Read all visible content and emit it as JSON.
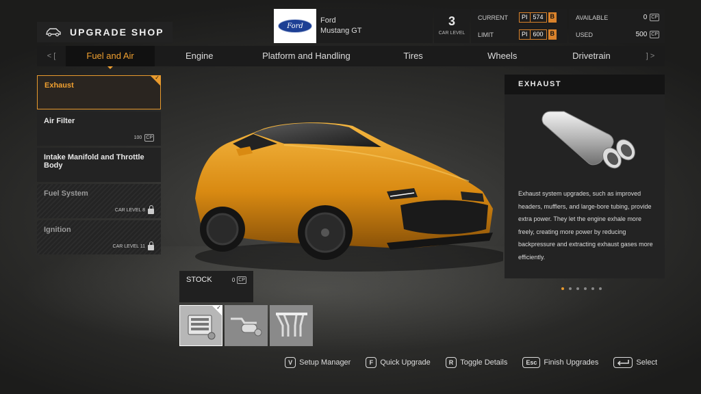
{
  "header": {
    "title": "UPGRADE SHOP",
    "car": {
      "logo": "Ford",
      "make": "Ford",
      "model": "Mustang GT"
    },
    "car_level": {
      "value": "3",
      "label": "CAR LEVEL"
    },
    "pi": {
      "current_label": "CURRENT",
      "current_value": "574",
      "current_class": "B",
      "limit_label": "LIMIT",
      "limit_value": "600",
      "limit_class": "B",
      "pi_tag": "PI"
    },
    "cp": {
      "available_label": "AVAILABLE",
      "available_value": "0",
      "used_label": "USED",
      "used_value": "500",
      "tag": "CP"
    }
  },
  "tabs": {
    "prev": "< [",
    "next": "] >",
    "items": [
      {
        "label": "Fuel and Air",
        "active": true
      },
      {
        "label": "Engine"
      },
      {
        "label": "Platform and Handling"
      },
      {
        "label": "Tires"
      },
      {
        "label": "Wheels"
      },
      {
        "label": "Drivetrain"
      }
    ]
  },
  "parts": [
    {
      "name": "Exhaust",
      "state": "active",
      "meta": ""
    },
    {
      "name": "Air Filter",
      "state": "normal",
      "meta": "100"
    },
    {
      "name": "Intake Manifold and Throttle Body",
      "state": "normal",
      "meta": ""
    },
    {
      "name": "Fuel System",
      "state": "locked",
      "meta": "CAR LEVEL  8"
    },
    {
      "name": "Ignition",
      "state": "locked",
      "meta": "CAR LEVEL  11"
    }
  ],
  "info": {
    "title": "EXHAUST",
    "description": "Exhaust system upgrades, such as improved headers, mufflers, and large-bore tubing, provide extra power. They let the engine exhale more freely, creating more power by reducing backpressure and extracting exhaust gases more efficiently.",
    "pages": 6,
    "current_page": 0
  },
  "stock": {
    "name": "STOCK",
    "cost": "0"
  },
  "thumbnails": [
    {
      "icon": "stock-exhaust-icon",
      "selected": true
    },
    {
      "icon": "muffler-icon"
    },
    {
      "icon": "headers-icon"
    }
  ],
  "hints": [
    {
      "key": "V",
      "label": "Setup Manager"
    },
    {
      "key": "F",
      "label": "Quick Upgrade"
    },
    {
      "key": "R",
      "label": "Toggle Details"
    },
    {
      "key": "Esc",
      "label": "Finish Upgrades"
    },
    {
      "key": "",
      "label": "Select"
    }
  ],
  "colors": {
    "accent": "#e89a2d",
    "panel": "#232323",
    "car_paint": "#e8a020"
  }
}
